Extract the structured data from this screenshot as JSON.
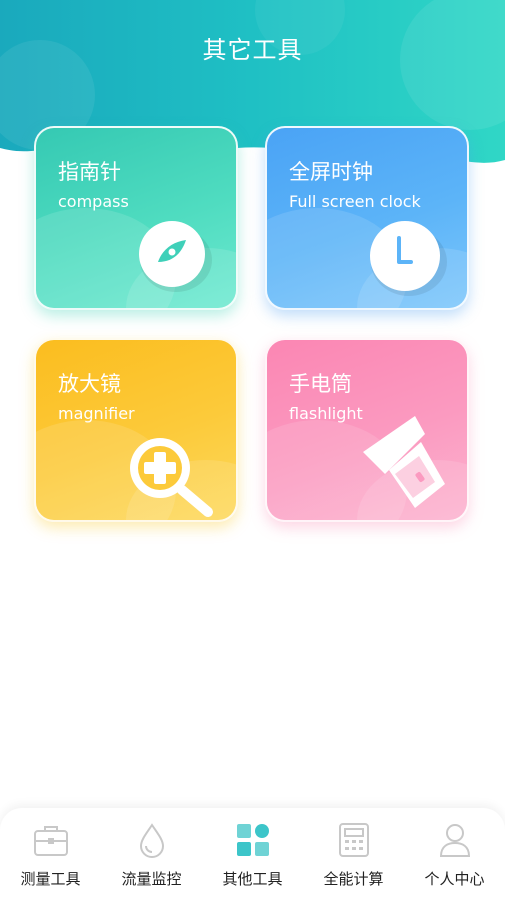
{
  "header": {
    "title": "其它工具"
  },
  "cards": [
    {
      "id": "compass",
      "title": "指南针",
      "subtitle": "compass",
      "icon": "compass-icon"
    },
    {
      "id": "clock",
      "title": "全屏时钟",
      "subtitle": "Full screen clock",
      "icon": "clock-icon"
    },
    {
      "id": "magnifier",
      "title": "放大镜",
      "subtitle": "magnifier",
      "icon": "magnifier-icon"
    },
    {
      "id": "flashlight",
      "title": "手电筒",
      "subtitle": "flashlight",
      "icon": "flashlight-icon"
    }
  ],
  "tabbar": {
    "items": [
      {
        "label": "测量工具",
        "icon": "toolbox-icon",
        "active": false
      },
      {
        "label": "流量监控",
        "icon": "droplet-icon",
        "active": false
      },
      {
        "label": "其他工具",
        "icon": "grid-icon",
        "active": true
      },
      {
        "label": "全能计算",
        "icon": "calculator-icon",
        "active": false
      },
      {
        "label": "个人中心",
        "icon": "person-icon",
        "active": false
      }
    ]
  },
  "colors": {
    "header_teal": "#1fbfc4",
    "compass": "#4fdcc0",
    "clock": "#5cb4f8",
    "magnifier": "#fcca3a",
    "flashlight": "#fb9ac0",
    "tab_active": "#3cc5c9",
    "tab_inactive": "#c8c8c8"
  }
}
